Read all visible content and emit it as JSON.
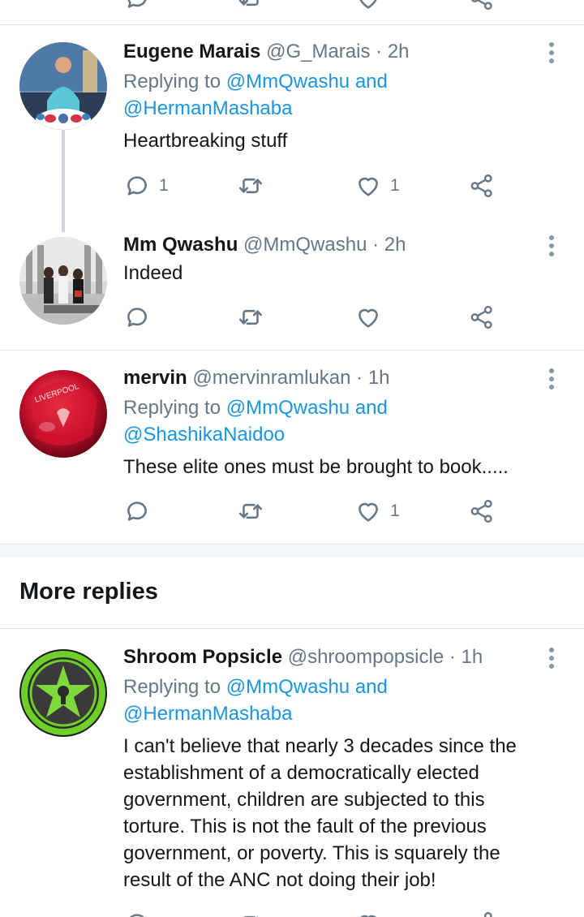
{
  "tweets": [
    {
      "name": "Eugene Marais",
      "handle": "@G_Marais",
      "dot": "·",
      "time": "2h",
      "replying_prefix": "Replying to",
      "replying_to_1": "@MmQwashu",
      "replying_and": "and",
      "replying_to_2": "@HermanMashaba",
      "body": "Heartbreaking stuff",
      "reply_count": "1",
      "retweet_count": "",
      "like_count": "1"
    },
    {
      "name": "Mm Qwashu",
      "handle": "@MmQwashu",
      "dot": "·",
      "time": "2h",
      "body": "Indeed",
      "reply_count": "",
      "retweet_count": "",
      "like_count": ""
    },
    {
      "name": "mervin",
      "handle": "@mervinramlukan",
      "dot": "·",
      "time": "1h",
      "replying_prefix": "Replying to",
      "replying_to_1": "@MmQwashu",
      "replying_and": "and",
      "replying_to_2": "@ShashikaNaidoo",
      "body": "These elite ones must be brought to book.....",
      "reply_count": "",
      "retweet_count": "",
      "like_count": "1"
    },
    {
      "name": "Shroom Popsicle",
      "handle": "@shroompopsicle",
      "dot": "·",
      "time": "1h",
      "replying_prefix": "Replying to",
      "replying_to_1": "@MmQwashu",
      "replying_and": "and",
      "replying_to_2": "@HermanMashaba",
      "body_lines": [
        "I can't believe that nearly 3 decades since the",
        "establishment of a democratically elected",
        "government, children are subjected to this",
        "torture.  This is not the fault of the previous",
        "government, or poverty.  This is squarely the",
        "result of the ANC not doing their job!"
      ]
    }
  ],
  "more_replies_title": "More replies",
  "colors": {
    "link": "#1b95e0",
    "secondary_text": "#657786",
    "primary_text": "#14171a",
    "divider": "#e1e8ed"
  },
  "icons": [
    "reply-icon",
    "retweet-icon",
    "like-icon",
    "share-icon",
    "more-icon"
  ]
}
